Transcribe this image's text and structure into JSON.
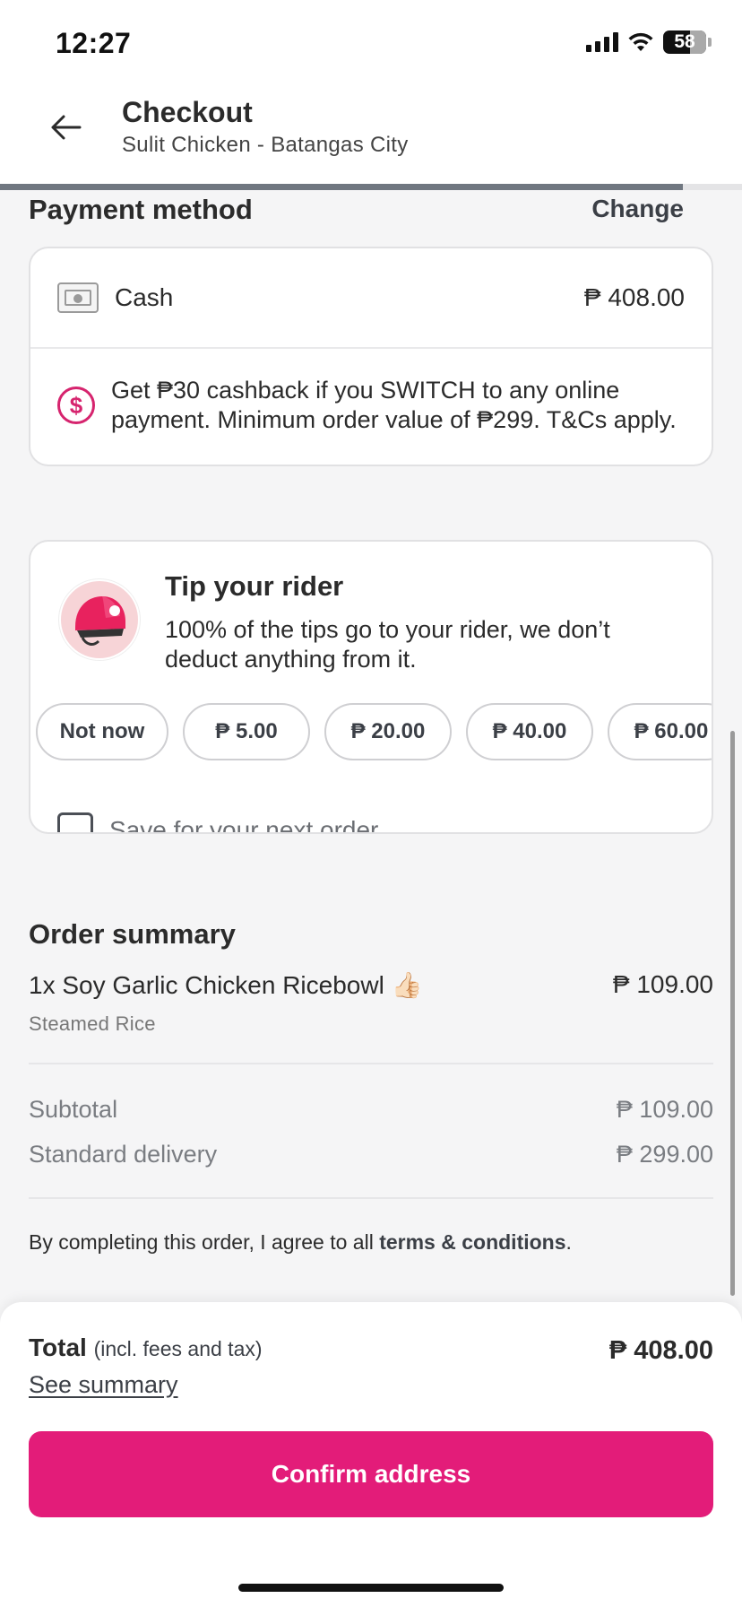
{
  "status_bar": {
    "time": "12:27",
    "battery": "58"
  },
  "header": {
    "title": "Checkout",
    "subtitle": "Sulit Chicken - Batangas City"
  },
  "checkout_progress": 0.92,
  "payment": {
    "title": "Payment method",
    "change_label": "Change",
    "method_label": "Cash",
    "amount": "₱ 408.00",
    "promo_icon": "dollar-circle-icon",
    "promo_text": "Get ₱30 cashback if you SWITCH to any online payment. Minimum order value of ₱299. T&Cs apply."
  },
  "tip": {
    "title": "Tip your rider",
    "description": "100% of the tips go to your rider, we don’t deduct anything from it.",
    "options": [
      "Not now",
      "₱ 5.00",
      "₱ 20.00",
      "₱ 40.00",
      "₱ 60.00"
    ],
    "save_label": "Save for your next order"
  },
  "order_summary": {
    "title": "Order summary",
    "item": {
      "name": "1x Soy Garlic Chicken Ricebowl",
      "emoji": "👍🏻",
      "price": "₱ 109.00",
      "option": "Steamed Rice"
    },
    "subtotal_label": "Subtotal",
    "subtotal_amount": "₱ 109.00",
    "delivery_label": "Standard delivery",
    "delivery_amount": "₱ 299.00"
  },
  "terms": {
    "prefix": "By completing this order, I agree to all ",
    "link": "terms & conditions",
    "suffix": "."
  },
  "footer": {
    "total_label": "Total",
    "total_note": "(incl. fees and tax)",
    "total_amount": "₱ 408.00",
    "see_summary": "See summary",
    "confirm_label": "Confirm address"
  },
  "colors": {
    "accent": "#e31c79",
    "promo": "#d6246e"
  }
}
